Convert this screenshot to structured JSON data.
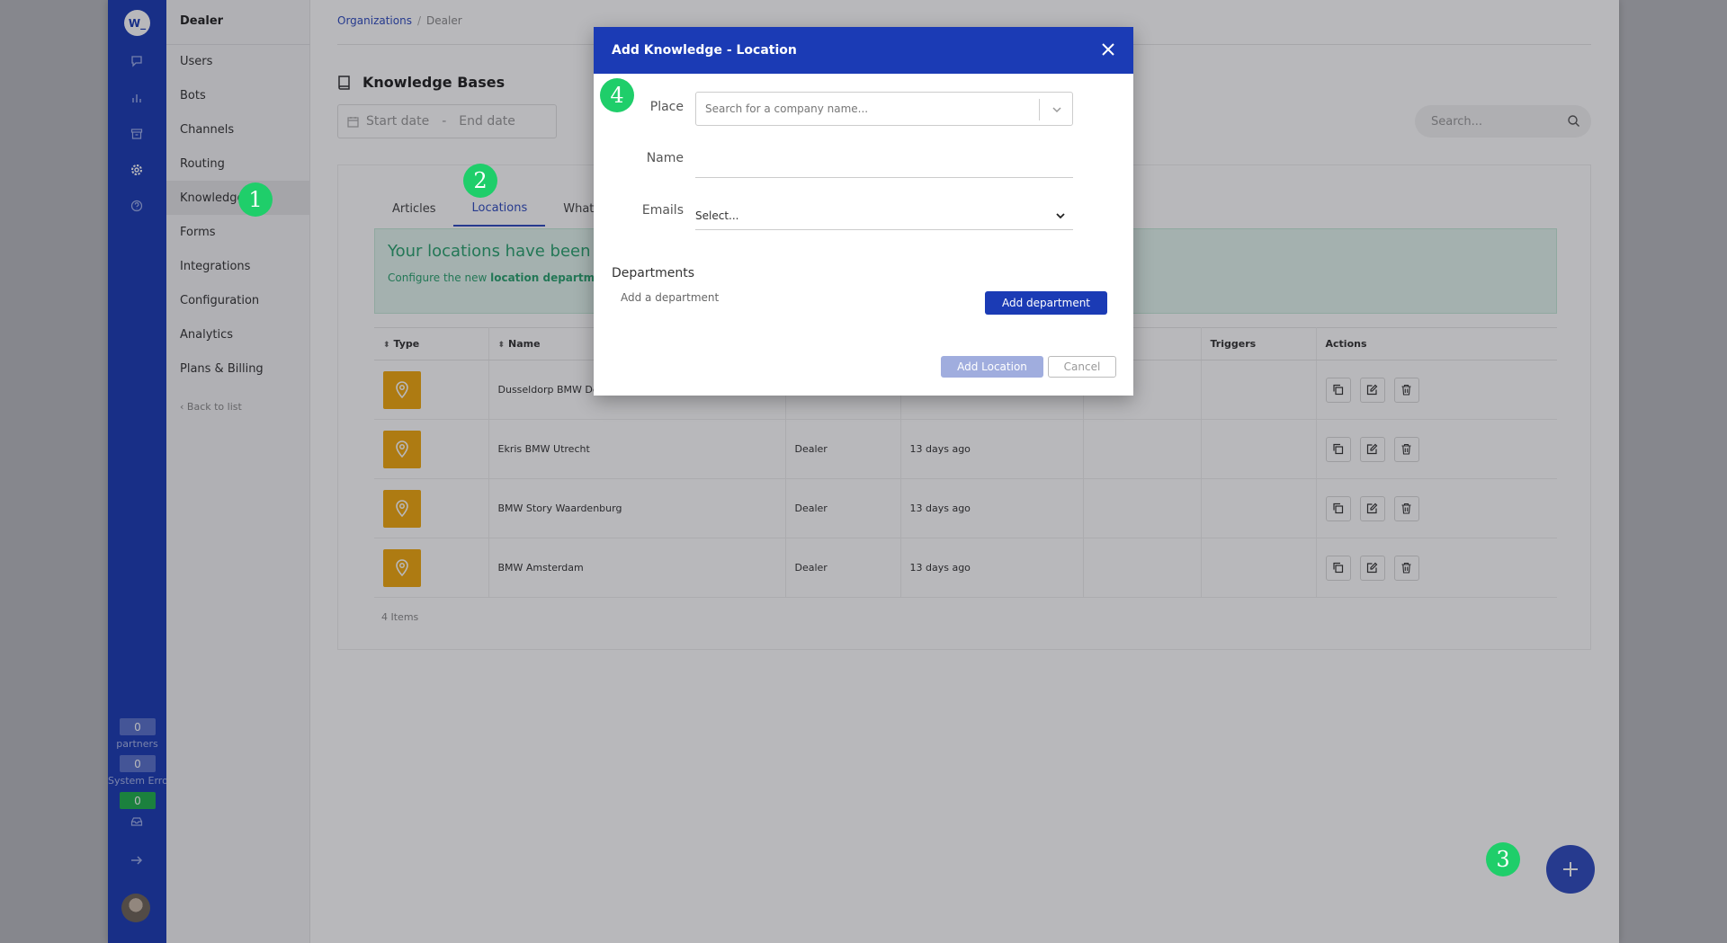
{
  "rail": {
    "logo": "W_",
    "counters": [
      {
        "value": "0",
        "label": "partners"
      },
      {
        "value": "0",
        "label": "System Erro"
      },
      {
        "value": "0",
        "label": ""
      }
    ]
  },
  "sidebar": {
    "title": "Dealer",
    "items": [
      "Users",
      "Bots",
      "Channels",
      "Routing",
      "Knowledge",
      "Forms",
      "Integrations",
      "Configuration",
      "Analytics",
      "Plans & Billing"
    ],
    "active_index": 4,
    "back": "Back to list"
  },
  "breadcrumb": {
    "root": "Organizations",
    "current": "Dealer"
  },
  "page": {
    "title": "Knowledge Bases"
  },
  "daterange": {
    "start": "Start date",
    "separator": "-",
    "end": "End date"
  },
  "search": {
    "placeholder": "Search..."
  },
  "tabs": [
    "Articles",
    "Locations",
    "WhatsA"
  ],
  "notice": {
    "title": "Your locations have been upg",
    "subtitle_prefix": "Configure the new ",
    "subtitle_link": "location departments"
  },
  "table": {
    "headers": [
      "Type",
      "Name",
      "",
      "",
      "",
      "Triggers",
      "Actions"
    ],
    "rows": [
      {
        "name": "Dusseldorp BMW Der",
        "org": "",
        "updated": ""
      },
      {
        "name": "Ekris BMW Utrecht",
        "org": "Dealer",
        "updated": "13 days ago"
      },
      {
        "name": "BMW Story Waardenburg",
        "org": "Dealer",
        "updated": "13 days ago"
      },
      {
        "name": "BMW Amsterdam",
        "org": "Dealer",
        "updated": "13 days ago"
      }
    ],
    "count": "4 Items"
  },
  "modal": {
    "title": "Add Knowledge - Location",
    "place_label": "Place",
    "place_placeholder": "Search for a company name...",
    "name_label": "Name",
    "emails_label": "Emails",
    "emails_value": "Select...",
    "departments_title": "Departments",
    "departments_hint": "Add a department",
    "add_department": "Add department",
    "add_location": "Add Location",
    "cancel": "Cancel"
  },
  "badges": [
    "1",
    "2",
    "3",
    "4"
  ],
  "colors": {
    "brand": "#1b3bb5",
    "pin": "#f1a80e",
    "badge": "#1fce6a",
    "notice_text": "#2aa36f"
  }
}
